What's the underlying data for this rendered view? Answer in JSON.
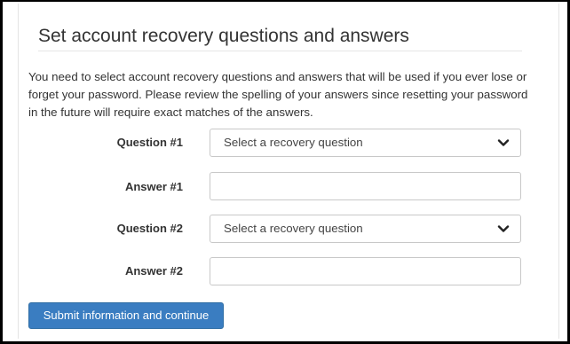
{
  "form": {
    "title": "Set account recovery questions and answers",
    "description": "You need to select account recovery questions and answers that will be used if you ever lose or forget your password. Please review the spelling of your answers since resetting your password in the future will require exact matches of the answers.",
    "question1_label": "Question #1",
    "question1_value": "Select a recovery question",
    "answer1_label": "Answer #1",
    "answer1_value": "",
    "question2_label": "Question #2",
    "question2_value": "Select a recovery question",
    "answer2_label": "Answer #2",
    "answer2_value": "",
    "submit_label": "Submit information and continue"
  },
  "icons": {
    "dropdown": "chevron-down-icon"
  },
  "colors": {
    "button": "#3a7dc1",
    "text": "#333333"
  }
}
